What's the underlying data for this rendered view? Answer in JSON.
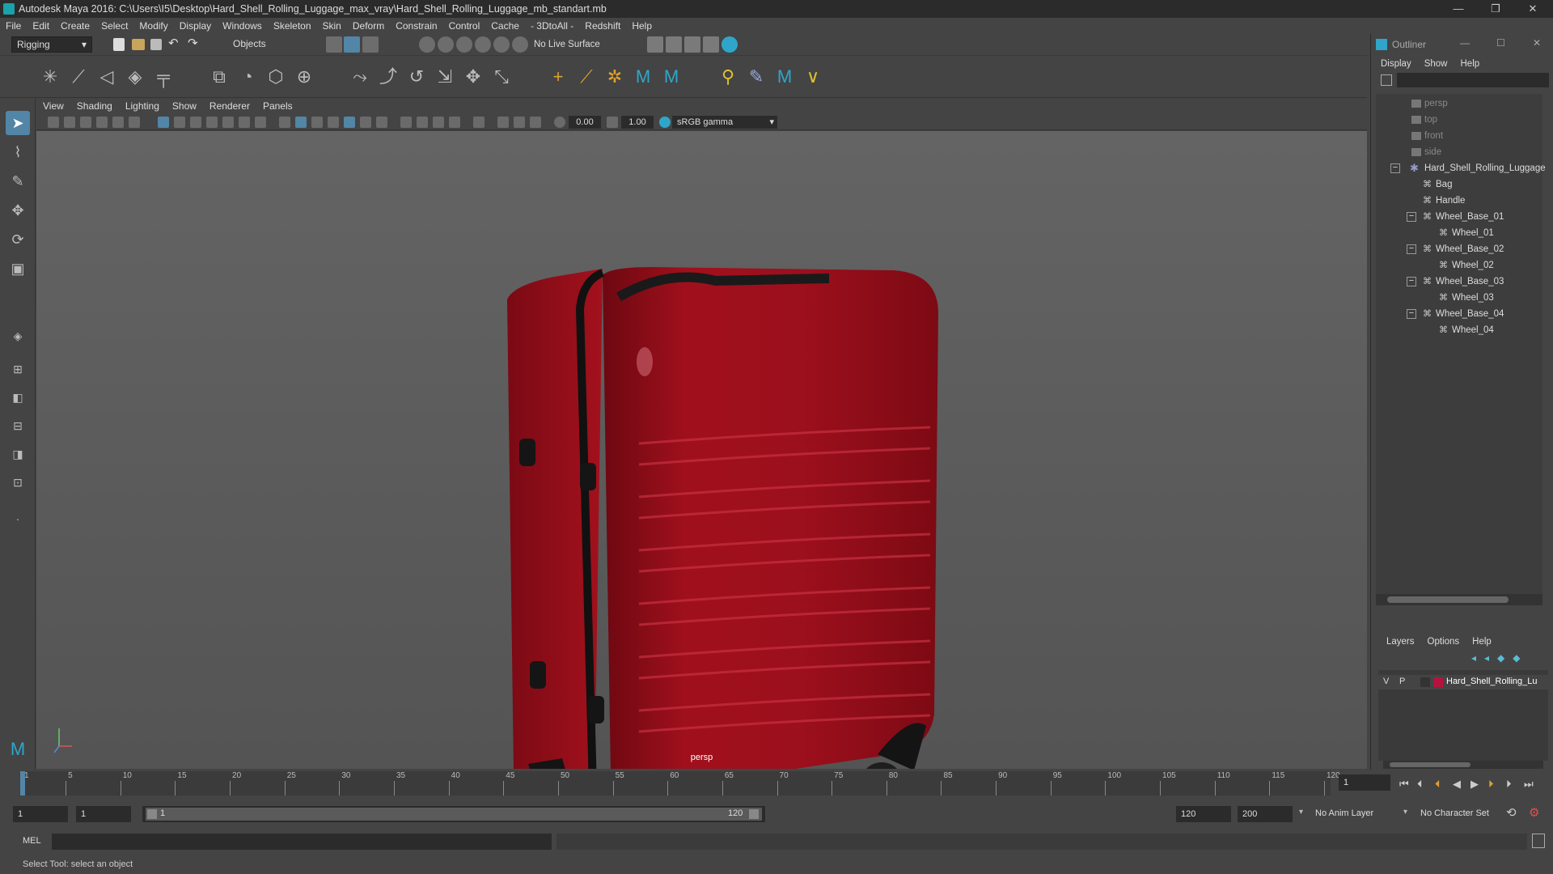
{
  "window": {
    "title": "Autodesk Maya 2016: C:\\Users\\I5\\Desktop\\Hard_Shell_Rolling_Luggage_max_vray\\Hard_Shell_Rolling_Luggage_mb_standart.mb",
    "minimize": "—",
    "maximize": "❐",
    "close": "✕"
  },
  "menubar": [
    "File",
    "Edit",
    "Create",
    "Select",
    "Modify",
    "Display",
    "Windows",
    "Skeleton",
    "Skin",
    "Deform",
    "Constrain",
    "Control",
    "Cache",
    "- 3DtoAll -",
    "Redshift",
    "Help"
  ],
  "statusline": {
    "menuset": "Rigging",
    "selection_mode": "Objects",
    "live_surface": "No Live Surface"
  },
  "panel_menu": [
    "View",
    "Shading",
    "Lighting",
    "Show",
    "Renderer",
    "Panels"
  ],
  "panel_toolbar": {
    "exposure": "0.00",
    "gamma": "1.00",
    "colorspace": "sRGB gamma"
  },
  "viewport": {
    "camera_label": "persp"
  },
  "outliner": {
    "title": "Outliner",
    "menu": [
      "Display",
      "Show",
      "Help"
    ],
    "cameras": [
      "persp",
      "top",
      "front",
      "side"
    ],
    "root": "Hard_Shell_Rolling_Luggage",
    "children": [
      "Bag",
      "Handle"
    ],
    "wheel_groups": [
      {
        "base": "Wheel_Base_01",
        "wheel": "Wheel_01"
      },
      {
        "base": "Wheel_Base_02",
        "wheel": "Wheel_02"
      },
      {
        "base": "Wheel_Base_03",
        "wheel": "Wheel_03"
      },
      {
        "base": "Wheel_Base_04",
        "wheel": "Wheel_04"
      }
    ]
  },
  "layers": {
    "menu": [
      "Layers",
      "Options",
      "Help"
    ],
    "row": {
      "v": "V",
      "p": "P",
      "name": "Hard_Shell_Rolling_Lu",
      "color": "#b3143c"
    }
  },
  "timeline": {
    "ticks": [
      "1",
      "5",
      "10",
      "15",
      "20",
      "25",
      "30",
      "35",
      "40",
      "45",
      "50",
      "55",
      "60",
      "65",
      "70",
      "75",
      "80",
      "85",
      "90",
      "95",
      "100",
      "105",
      "110",
      "115",
      "120"
    ],
    "current_frame": "1"
  },
  "range": {
    "start": "1",
    "start2": "1",
    "slider_start": "1",
    "slider_end": "120",
    "end": "120",
    "end2": "200",
    "anim_layer": "No Anim Layer",
    "char_set": "No Character Set"
  },
  "cmdline": {
    "lang": "MEL"
  },
  "helpline": {
    "text": "Select Tool: select an object"
  },
  "colors": {
    "accent": "#5285a6",
    "luggage": "#9c0f1c"
  }
}
